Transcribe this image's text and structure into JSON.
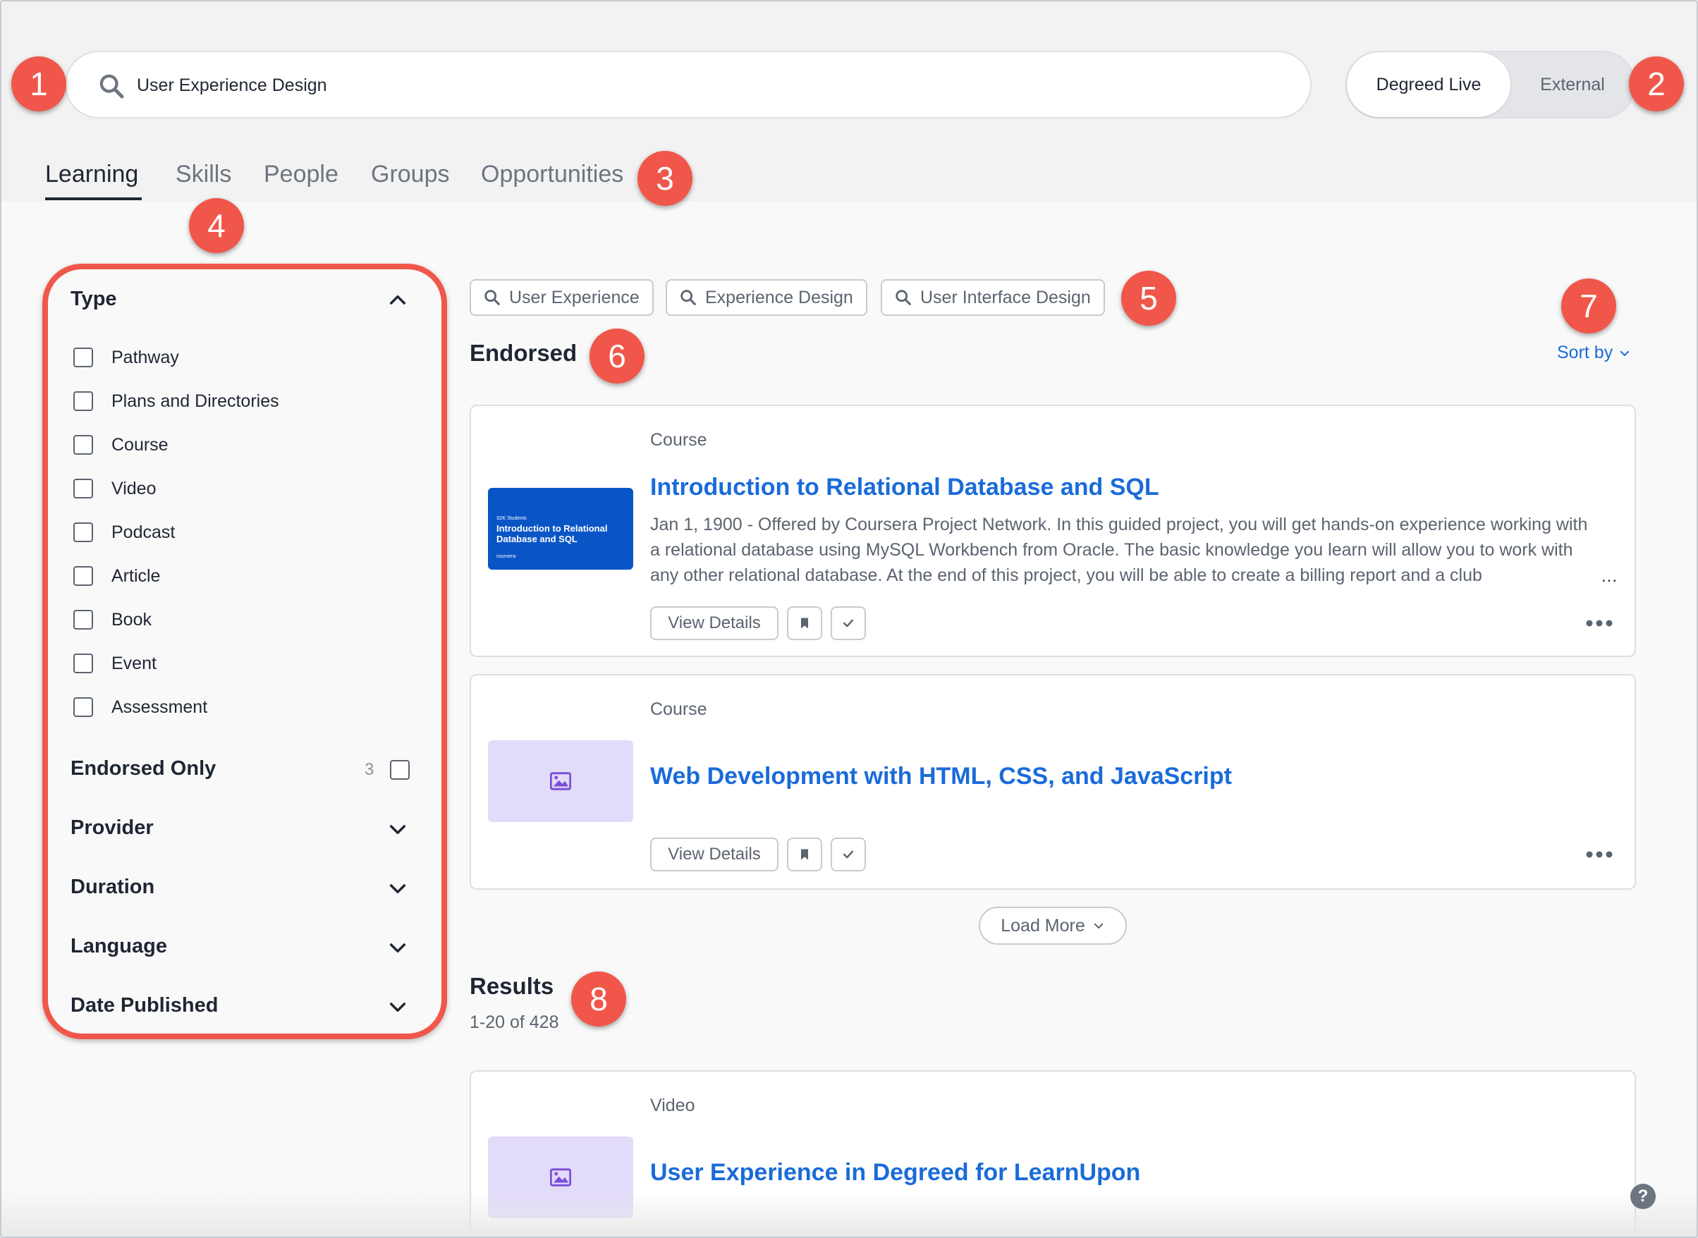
{
  "search": {
    "value": "User Experience Design"
  },
  "toggle": {
    "active": "Degreed Live",
    "inactive": "External"
  },
  "tabs": [
    "Learning",
    "Skills",
    "People",
    "Groups",
    "Opportunities"
  ],
  "callouts": [
    "1",
    "2",
    "3",
    "4",
    "5",
    "6",
    "7",
    "8"
  ],
  "filters": {
    "type_heading": "Type",
    "types": [
      "Pathway",
      "Plans and Directories",
      "Course",
      "Video",
      "Podcast",
      "Article",
      "Book",
      "Event",
      "Assessment"
    ],
    "endorsed_label": "Endorsed Only",
    "endorsed_count": "3",
    "sections": [
      "Provider",
      "Duration",
      "Language",
      "Date Published"
    ]
  },
  "suggestions": [
    "User Experience",
    "Experience Design",
    "User Interface Design"
  ],
  "endorsed": {
    "title": "Endorsed",
    "sort_label": "Sort by",
    "cards": [
      {
        "type": "Course",
        "title": "Introduction to Relational Database and SQL",
        "description": "Jan 1, 1900 - Offered by Coursera Project Network. In this guided project, you will get hands-on experience working with a relational database using MySQL Workbench from Oracle. The basic knowledge you learn will allow you to work with any other relational database. At the end of this project, you will be able to create a billing report and a club",
        "view_label": "View Details",
        "thumb": {
          "line1": "S2K Students",
          "line2": "Introduction to Relational Database and SQL",
          "line3": "coursera"
        }
      },
      {
        "type": "Course",
        "title": "Web Development with HTML, CSS, and JavaScript",
        "view_label": "View Details"
      }
    ],
    "load_more": "Load More"
  },
  "results": {
    "title": "Results",
    "count": "1-20 of 428",
    "cards": [
      {
        "type": "Video",
        "title": "User Experience in Degreed for LearnUpon"
      }
    ]
  },
  "help_label": "?",
  "colors": {
    "accent": "#f0574a",
    "link": "#1a6bd9",
    "text": "#1f2633",
    "muted": "#5b6470"
  }
}
